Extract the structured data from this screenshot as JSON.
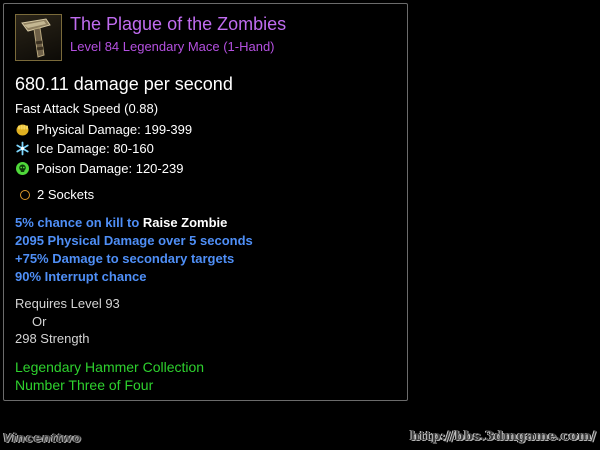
{
  "item": {
    "name": "The Plague of the Zombies",
    "type_line": "Level 84 Legendary Mace (1-Hand)",
    "icon": "mace-icon",
    "name_color": "#c06cf0",
    "dps": "680.11 damage per second"
  },
  "stats": {
    "attack_speed": "Fast Attack Speed (0.88)",
    "physical": "Physical Damage: 199-399",
    "ice": "Ice Damage: 80-160",
    "poison": "Poison Damage: 120-239",
    "sockets": "2 Sockets"
  },
  "affixes": {
    "raise_zombie_prefix": "5% chance on kill to ",
    "raise_zombie_skill": "Raise Zombie",
    "bleed": "2095 Physical Damage over 5 seconds",
    "secondary": "+75% Damage to secondary targets",
    "interrupt": "90% Interrupt chance"
  },
  "requirements": {
    "level": "Requires Level 93",
    "or": "Or",
    "strength": "298 Strength"
  },
  "set": {
    "name": "Legendary Hammer Collection",
    "progress": "Number Three of Four",
    "color": "#2ed12e"
  },
  "watermark": {
    "author": "Vincenttwo",
    "url": "http://bbs.3dmgame.com/"
  },
  "colors": {
    "affix_blue": "#4f8ff7",
    "physical_icon": "#e0b020",
    "ice_icon": "#7fd8ff",
    "poison_icon": "#4fd83a"
  }
}
